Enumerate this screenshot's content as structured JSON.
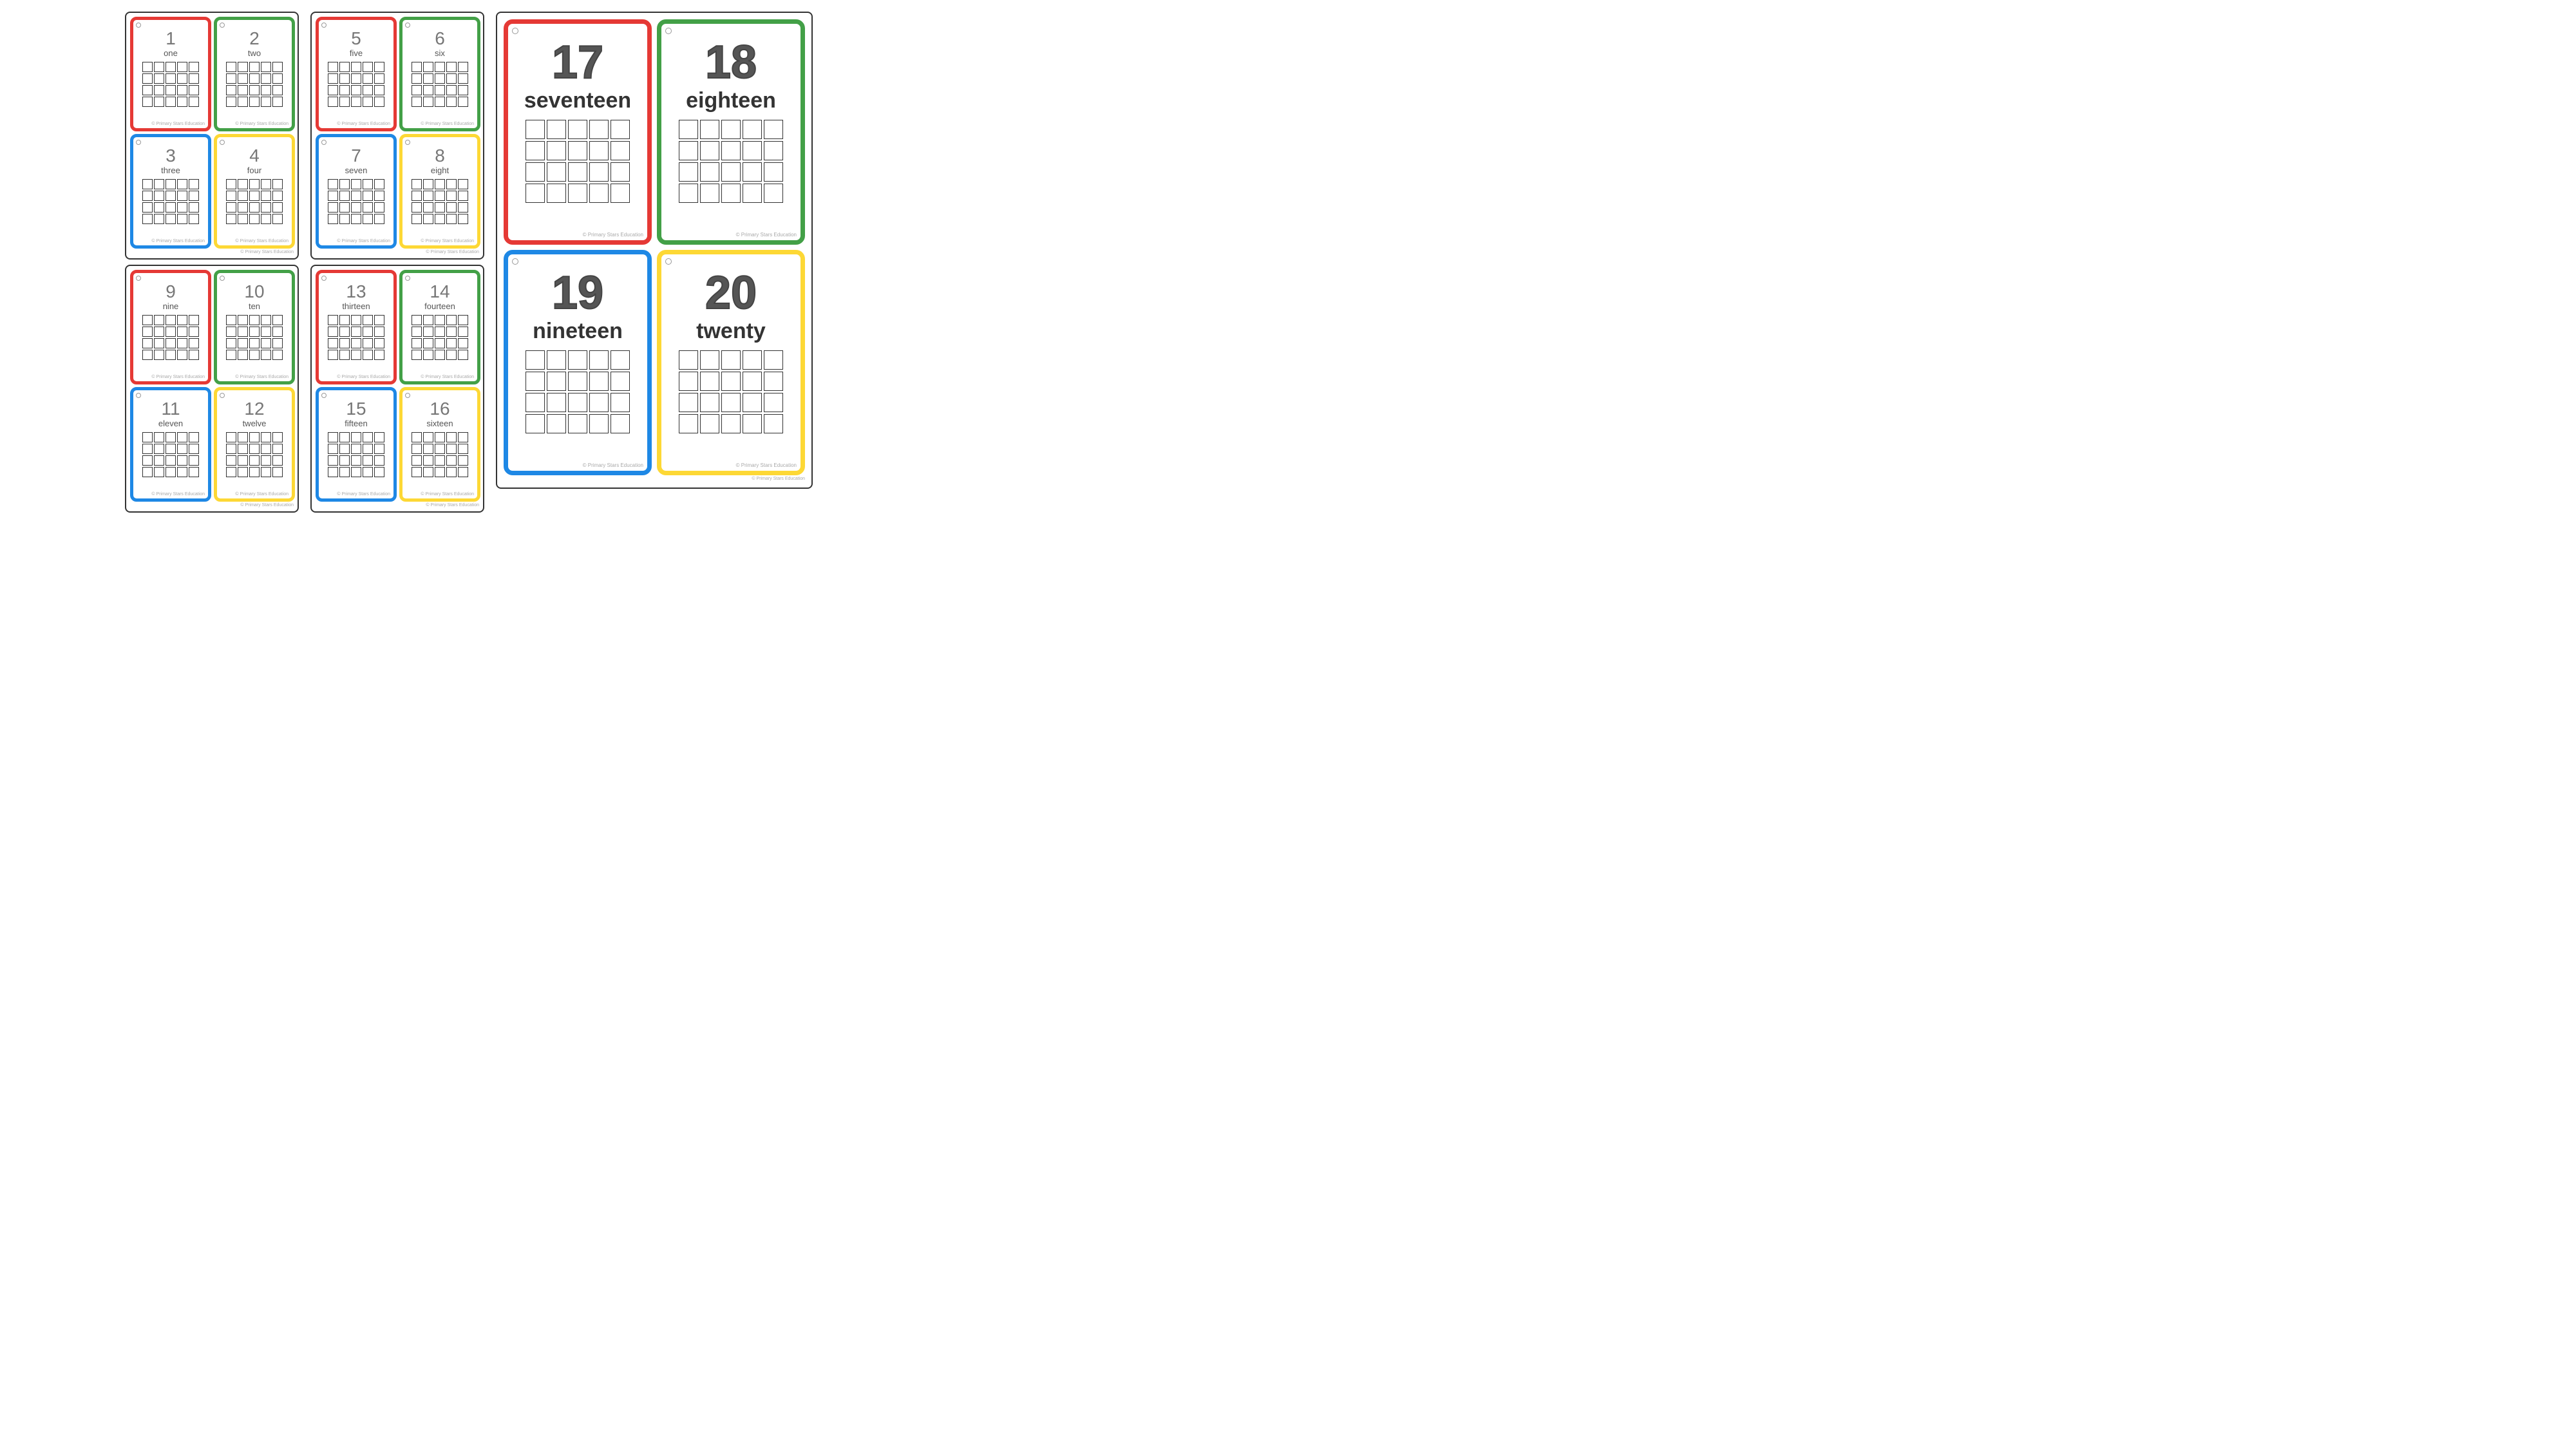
{
  "colors": {
    "red": "#e53935",
    "green": "#43a047",
    "blue": "#1e88e5",
    "yellow": "#fdd835"
  },
  "cards": [
    {
      "num": "1",
      "word": "one",
      "color": "red"
    },
    {
      "num": "2",
      "word": "two",
      "color": "green"
    },
    {
      "num": "3",
      "word": "three",
      "color": "blue"
    },
    {
      "num": "4",
      "word": "four",
      "color": "yellow"
    },
    {
      "num": "5",
      "word": "five",
      "color": "red"
    },
    {
      "num": "6",
      "word": "six",
      "color": "green"
    },
    {
      "num": "7",
      "word": "seven",
      "color": "blue"
    },
    {
      "num": "8",
      "word": "eight",
      "color": "yellow"
    },
    {
      "num": "9",
      "word": "nine",
      "color": "red"
    },
    {
      "num": "10",
      "word": "ten",
      "color": "green"
    },
    {
      "num": "11",
      "word": "eleven",
      "color": "blue"
    },
    {
      "num": "12",
      "word": "twelve",
      "color": "yellow"
    },
    {
      "num": "13",
      "word": "thirteen",
      "color": "red"
    },
    {
      "num": "14",
      "word": "fourteen",
      "color": "green"
    },
    {
      "num": "15",
      "word": "fifteen",
      "color": "blue"
    },
    {
      "num": "16",
      "word": "sixteen",
      "color": "yellow"
    },
    {
      "num": "17",
      "word": "seventeen",
      "color": "red"
    },
    {
      "num": "18",
      "word": "eighteen",
      "color": "green"
    },
    {
      "num": "19",
      "word": "nineteen",
      "color": "blue"
    },
    {
      "num": "20",
      "word": "twenty",
      "color": "yellow"
    }
  ],
  "copyright": "© Primary Stars Education"
}
